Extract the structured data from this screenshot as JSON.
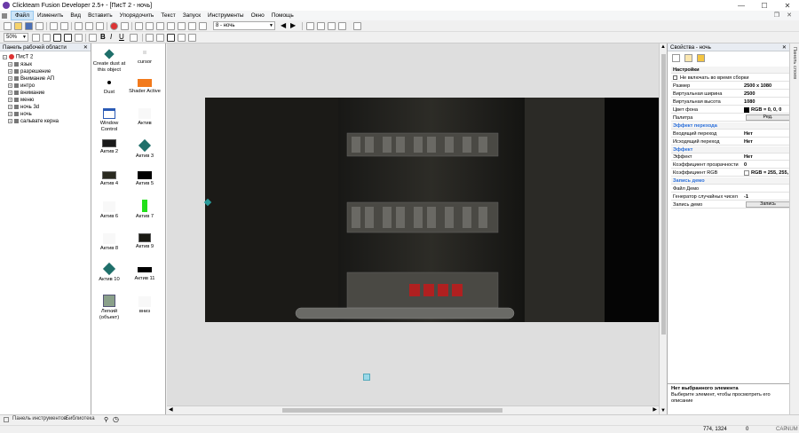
{
  "app": {
    "title": "Clickteam Fusion Developer 2.5+ - [ПисТ 2 - ночь]"
  },
  "menu": [
    "Файл",
    "Изменить",
    "Вид",
    "Вставить",
    "Упорядочить",
    "Текст",
    "Запуск",
    "Инструменты",
    "Окно",
    "Помощь"
  ],
  "toolbar": {
    "frame_combo": "8 - ночь",
    "zoom_combo": "50%"
  },
  "workspace": {
    "title": "Панель рабочей области",
    "root": "ПисТ 2",
    "items": [
      "язык",
      "разрешение",
      "Внимание АП",
      "интро",
      "внимание",
      "меню",
      "ночь 3d",
      "ночь",
      "сальвате керна"
    ]
  },
  "library": {
    "objects": [
      {
        "label": "Create dust at this object"
      },
      {
        "label": "cursor"
      },
      {
        "label": "Dust"
      },
      {
        "label": "Shader Active"
      },
      {
        "label": "Window Control"
      },
      {
        "label": "Актив"
      },
      {
        "label": "Актив 2"
      },
      {
        "label": "Актив 3"
      },
      {
        "label": "Актив 4"
      },
      {
        "label": "Актив 5"
      },
      {
        "label": "Актив 6"
      },
      {
        "label": "Актив 7"
      },
      {
        "label": "Актив 8"
      },
      {
        "label": "Актив 9"
      },
      {
        "label": "Актив 10"
      },
      {
        "label": "Актив 11"
      },
      {
        "label": "Легкий (объект)"
      },
      {
        "label": "вниз"
      }
    ]
  },
  "properties": {
    "title": "Свойства - ночь",
    "side_tab": "Панель слоев",
    "rows": [
      {
        "type": "section",
        "label": "Настройки"
      },
      {
        "type": "check",
        "label": "Не включать во время сборки"
      },
      {
        "type": "value",
        "label": "Размер",
        "value": "2500 x 1080"
      },
      {
        "type": "value",
        "label": "Виртуальная ширина",
        "value": "2500"
      },
      {
        "type": "value",
        "label": "Виртуальная высота",
        "value": "1080"
      },
      {
        "type": "color",
        "label": "Цвет фона",
        "value": "RGB = 0, 0, 0",
        "swatch": "#000000"
      },
      {
        "type": "button",
        "label": "Палитра",
        "value": "Ред."
      },
      {
        "type": "section-blue",
        "label": "Эффект перехода"
      },
      {
        "type": "value",
        "label": "Входящий переход",
        "value": "Нет"
      },
      {
        "type": "value",
        "label": "Исходящий переход",
        "value": "Нет"
      },
      {
        "type": "section-blue",
        "label": "Эффект"
      },
      {
        "type": "value",
        "label": "Эффект",
        "value": "Нет"
      },
      {
        "type": "value",
        "label": "Коэффициент прозрачности",
        "value": "0"
      },
      {
        "type": "color",
        "label": "Коэффициент RGB",
        "value": "RGB = 255, 255,",
        "swatch": "#ffffff"
      },
      {
        "type": "section-blue",
        "label": "Запись демо"
      },
      {
        "type": "value",
        "label": "Файл Демо",
        "value": ""
      },
      {
        "type": "value",
        "label": "Генератор случайных чисел",
        "value": "-1"
      },
      {
        "type": "button",
        "label": "Запись демо",
        "value": "Запись"
      }
    ],
    "info_title": "Нет выбранного элемента",
    "info_text": "Выберите элемент, чтобы просмотреть его описание"
  },
  "statusbar": {
    "tools_tab": "Панель инструментов",
    "library_tab": "Библиотека",
    "coords": "774, 1324",
    "zero": "0",
    "caps": "CAP",
    "num": "NUM"
  }
}
